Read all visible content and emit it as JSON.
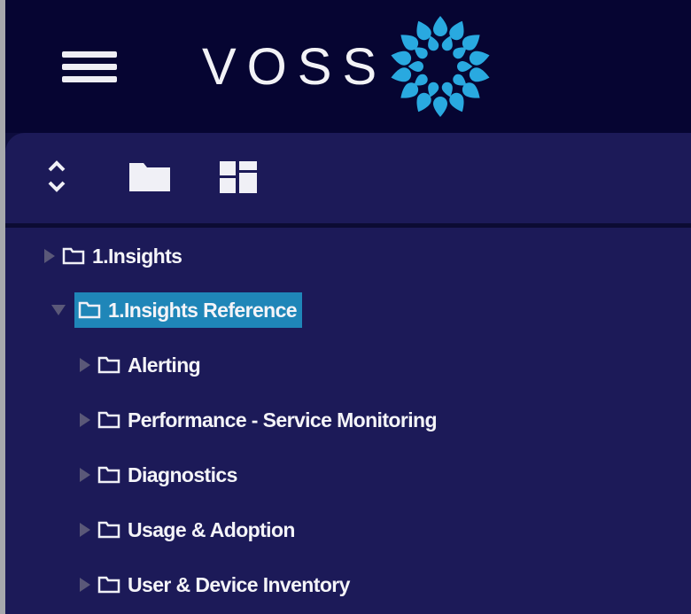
{
  "header": {
    "brand": "VOSS",
    "menu_icon": "hamburger-menu-icon",
    "logo_icon": "voss-logo-icon",
    "logo_color": "#29a9e0"
  },
  "toolbar": {
    "icons": [
      "expand-collapse-icon",
      "folder-icon",
      "dashboard-grid-icon"
    ]
  },
  "tree": {
    "items": [
      {
        "label": "1.Insights",
        "expanded": false,
        "selected": false,
        "level": 0
      },
      {
        "label": "1.Insights Reference",
        "expanded": true,
        "selected": true,
        "level": 0
      },
      {
        "label": "Alerting",
        "expanded": false,
        "selected": false,
        "level": 1
      },
      {
        "label": "Performance - Service Monitoring",
        "expanded": false,
        "selected": false,
        "level": 1
      },
      {
        "label": "Diagnostics",
        "expanded": false,
        "selected": false,
        "level": 1
      },
      {
        "label": "Usage & Adoption",
        "expanded": false,
        "selected": false,
        "level": 1
      },
      {
        "label": "User & Device Inventory",
        "expanded": false,
        "selected": false,
        "level": 1
      }
    ]
  },
  "colors": {
    "header_bg": "#060532",
    "panel_bg": "#1c1a58",
    "selection": "#1f86b8"
  }
}
